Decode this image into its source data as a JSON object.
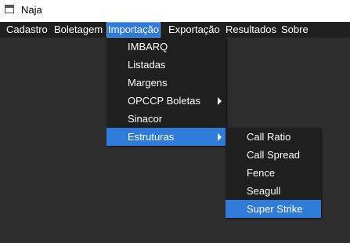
{
  "window": {
    "title": "Naja"
  },
  "menubar": {
    "items": [
      {
        "label": "Cadastro"
      },
      {
        "label": "Boletagem"
      },
      {
        "label": "Importação"
      },
      {
        "label": "Exportação"
      },
      {
        "label": "Resultados"
      },
      {
        "label": "Sobre"
      }
    ]
  },
  "importacao_menu": {
    "items": [
      {
        "label": "IMBARQ"
      },
      {
        "label": "Listadas"
      },
      {
        "label": "Margens"
      },
      {
        "label": "OPCCP Boletas"
      },
      {
        "label": "Sinacor"
      },
      {
        "label": "Estruturas"
      }
    ]
  },
  "estruturas_menu": {
    "items": [
      {
        "label": "Call Ratio"
      },
      {
        "label": "Call Spread"
      },
      {
        "label": "Fence"
      },
      {
        "label": "Seagull"
      },
      {
        "label": "Super Strike"
      }
    ]
  },
  "icons": {
    "app": "app-window-icon",
    "submenu": "submenu-arrow-icon"
  },
  "colors": {
    "menu_bg": "#1f1f1f",
    "highlight": "#2f7bd9",
    "content_bg": "#2e2e2e"
  }
}
